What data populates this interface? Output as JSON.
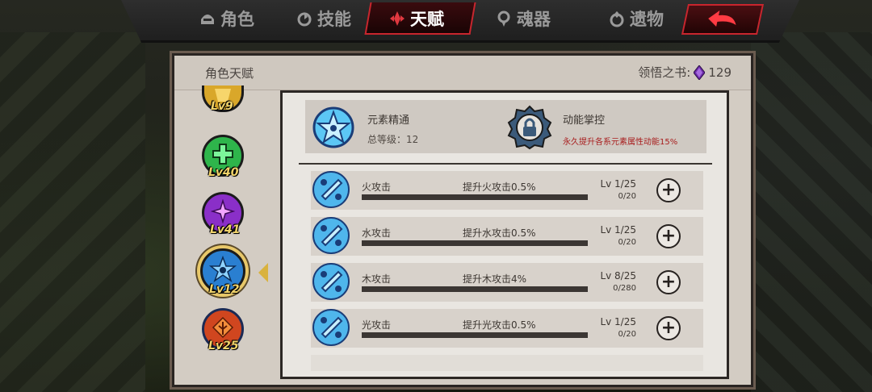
{
  "nav": {
    "tabs": [
      {
        "label": "角色",
        "icon": "helmet-icon"
      },
      {
        "label": "技能",
        "icon": "skill-icon"
      },
      {
        "label": "天赋",
        "icon": "talent-icon",
        "active": true
      },
      {
        "label": "魂器",
        "icon": "soul-vessel-icon"
      },
      {
        "label": "遗物",
        "icon": "relic-icon"
      }
    ],
    "back_icon": "back-arrow-icon"
  },
  "panel": {
    "title": "角色天赋",
    "book_label": "领悟之书:",
    "book_count": "129",
    "book_icon": "purple-gem-icon"
  },
  "characters": [
    {
      "level": "Lv9",
      "color": "#d9a72a",
      "icon": "gold-emblem-icon"
    },
    {
      "level": "Lv40",
      "color": "#2eb54b",
      "icon": "green-cross-icon"
    },
    {
      "level": "Lv41",
      "color": "#8a2fc8",
      "icon": "purple-star-icon"
    },
    {
      "level": "Lv12",
      "color": "#2a7fd1",
      "icon": "blue-star-icon",
      "selected": true
    },
    {
      "level": "Lv25",
      "color": "#d0461f",
      "icon": "red-tree-icon"
    }
  ],
  "summary": {
    "left_name": "元素精通",
    "left_level": "总等级：12",
    "right_name": "动能掌控",
    "right_desc": "永久提升各系元素属性动能15%",
    "right_icon": "lock-icon"
  },
  "talents": [
    {
      "name": "火攻击",
      "effect": "提升火攻击0.5%",
      "level": "Lv 1/25",
      "exp": "0/20",
      "progress": 0
    },
    {
      "name": "水攻击",
      "effect": "提升水攻击0.5%",
      "level": "Lv 1/25",
      "exp": "0/20",
      "progress": 0
    },
    {
      "name": "木攻击",
      "effect": "提升木攻击4%",
      "level": "Lv 8/25",
      "exp": "0/280",
      "progress": 0
    },
    {
      "name": "光攻击",
      "effect": "提升光攻击0.5%",
      "level": "Lv 1/25",
      "exp": "0/20",
      "progress": 0
    }
  ],
  "plus_label": "+"
}
